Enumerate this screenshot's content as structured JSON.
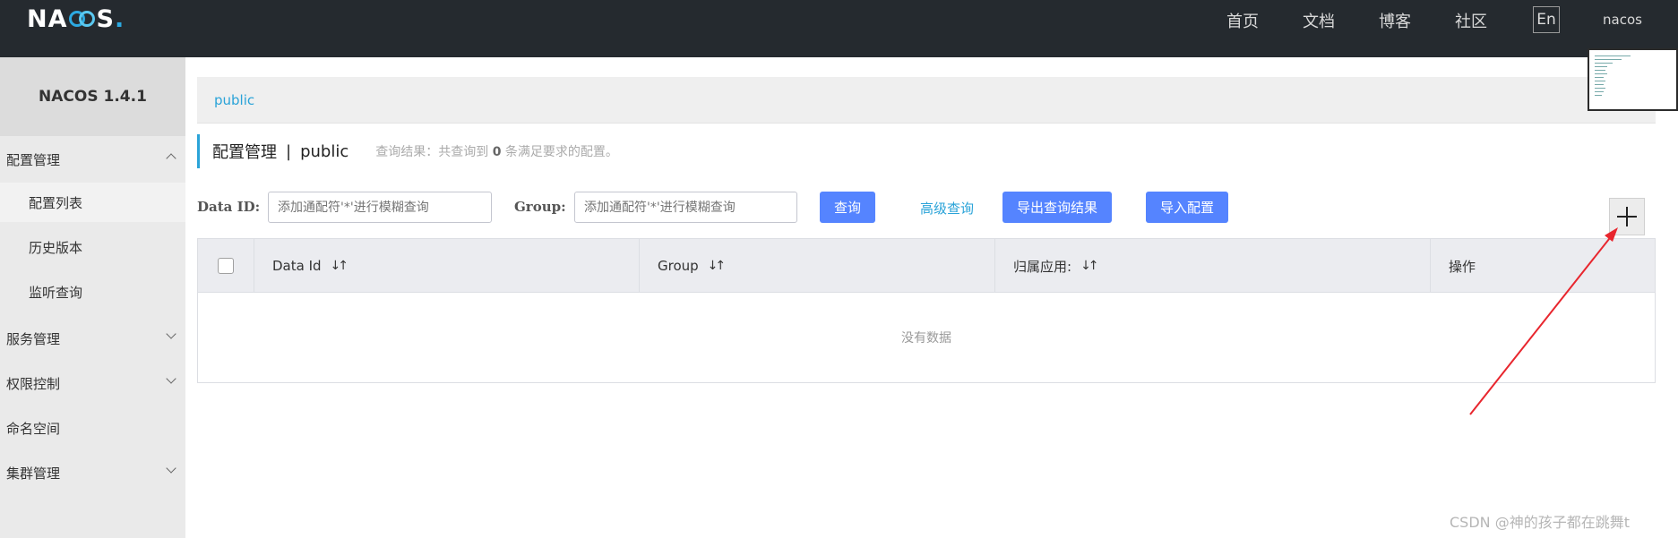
{
  "header": {
    "logo_text_left": "NA",
    "logo_text_right": "S",
    "logo_dot": ".",
    "nav": [
      "首页",
      "文档",
      "博客",
      "社区"
    ],
    "lang": "En",
    "user": "nacos"
  },
  "sidebar": {
    "brand": "NACOS 1.4.1",
    "groups": [
      {
        "label": "配置管理",
        "expanded": true
      },
      {
        "label": "服务管理",
        "expanded": false
      },
      {
        "label": "权限控制",
        "expanded": false
      },
      {
        "label": "命名空间"
      },
      {
        "label": "集群管理",
        "expanded": false
      }
    ],
    "config_items": [
      "配置列表",
      "历史版本",
      "监听查询"
    ]
  },
  "namespace": {
    "current": "public"
  },
  "title": {
    "main": "配置管理",
    "sep": "|",
    "ns": "public",
    "hint_prefix": "查询结果：共查询到",
    "hint_count": "0",
    "hint_suffix": "条满足要求的配置。"
  },
  "filters": {
    "data_id_label": "Data ID:",
    "data_id_placeholder": "添加通配符'*'进行模糊查询",
    "group_label": "Group:",
    "group_placeholder": "添加通配符'*'进行模糊查询",
    "query_btn": "查询",
    "advanced": "高级查询",
    "export_btn": "导出查询结果",
    "import_btn": "导入配置"
  },
  "table": {
    "columns": [
      "Data Id",
      "Group",
      "归属应用:",
      "操作"
    ],
    "sort_icon": "↓↑",
    "empty": "没有数据"
  },
  "watermark": "CSDN @神的孩子都在跳舞t",
  "colors": {
    "topbar": "#252a2f",
    "primary": "#5584ff",
    "link": "#2aa3d8",
    "annotation": "#e8262e"
  }
}
